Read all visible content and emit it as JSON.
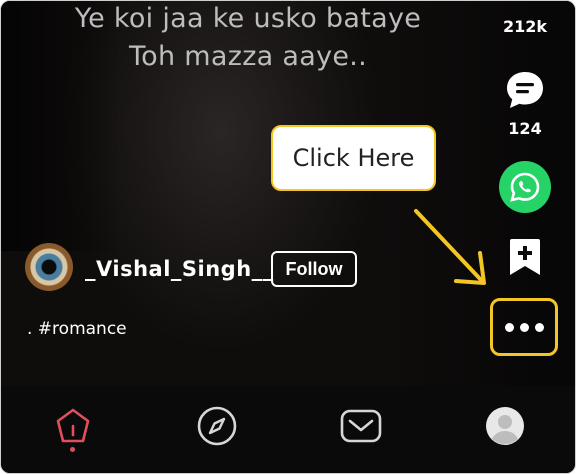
{
  "video": {
    "lyric_line1": "Ye koi jaa ke usko bataye",
    "lyric_line2": "Toh mazza aaye.."
  },
  "rail": {
    "likes_count": "212k",
    "comments_count": "124",
    "icons": [
      "comment-icon",
      "whatsapp-share-icon",
      "bookmark-add-icon",
      "more-options-icon"
    ]
  },
  "callout": {
    "text": "Click Here",
    "highlight_color": "#f3c623"
  },
  "post": {
    "username": "_Vishal_Singh__",
    "follow_label": "Follow",
    "caption": ". #romance"
  },
  "nav": {
    "items": [
      "home-icon",
      "explore-compass-icon",
      "inbox-mail-icon",
      "profile-avatar-icon"
    ],
    "active_color": "#e04f5c"
  },
  "colors": {
    "whatsapp_green": "#25d366",
    "background": "#0d0b0b"
  }
}
